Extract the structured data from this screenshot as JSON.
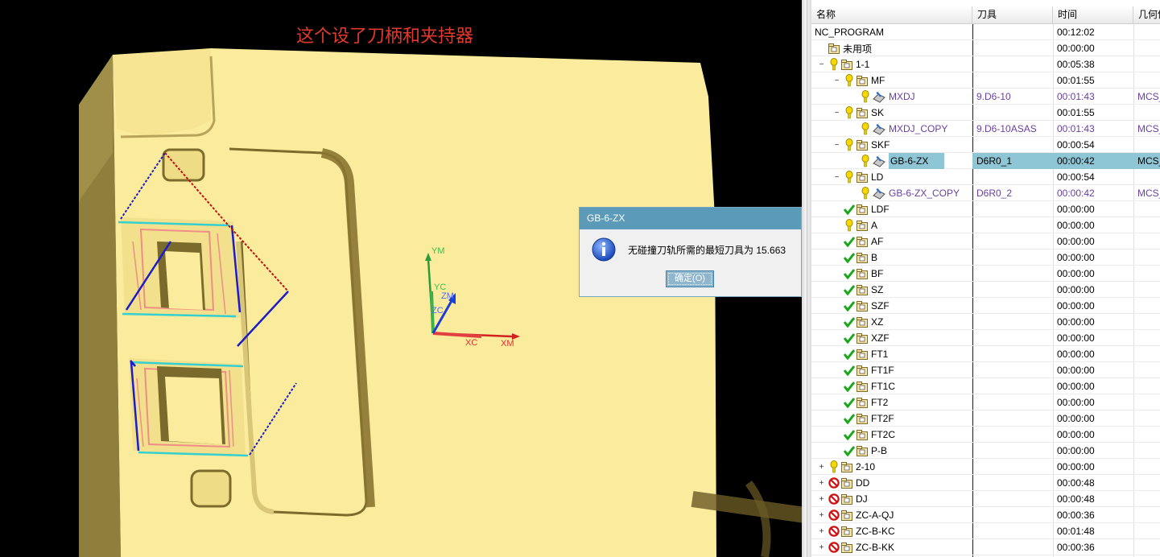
{
  "viewport": {
    "annotation": "这个设了刀柄和夹持器",
    "axis_labels": [
      "YM",
      "YC",
      "ZM",
      "ZC",
      "XC",
      "XM"
    ]
  },
  "dialog": {
    "title": "GB-6-ZX",
    "message": "无碰撞刀轨所需的最短刀具为 15.663",
    "ok_label": "确定(O)",
    "icon": "info-icon"
  },
  "navigator": {
    "columns": [
      "名称",
      "刀具",
      "时间",
      "几何体"
    ],
    "rows": [
      {
        "name": "NC_PROGRAM",
        "level": 0,
        "tool": "",
        "time": "00:12:02",
        "geom": "",
        "status": "none",
        "kind": "root"
      },
      {
        "name": "未用项",
        "level": 1,
        "tool": "",
        "time": "00:00:00",
        "geom": "",
        "status": "none",
        "kind": "folder"
      },
      {
        "name": "1-1",
        "level": 1,
        "tool": "",
        "time": "00:05:38",
        "geom": "",
        "status": "warn",
        "kind": "group",
        "expander": "-"
      },
      {
        "name": "MF",
        "level": 2,
        "tool": "",
        "time": "00:01:55",
        "geom": "",
        "status": "warn",
        "kind": "group",
        "expander": "-"
      },
      {
        "name": "MXDJ",
        "level": 3,
        "tool": "9.D6-10",
        "time": "00:01:43",
        "geom": "MCS_",
        "status": "warn",
        "kind": "op",
        "purple": true
      },
      {
        "name": "SK",
        "level": 2,
        "tool": "",
        "time": "00:01:55",
        "geom": "",
        "status": "warn",
        "kind": "group",
        "expander": "-"
      },
      {
        "name": "MXDJ_COPY",
        "level": 3,
        "tool": "9.D6-10ASAS",
        "time": "00:01:43",
        "geom": "MCS_",
        "status": "warn",
        "kind": "op",
        "purple": true
      },
      {
        "name": "SKF",
        "level": 2,
        "tool": "",
        "time": "00:00:54",
        "geom": "",
        "status": "warn",
        "kind": "group",
        "expander": "-"
      },
      {
        "name": "GB-6-ZX",
        "level": 3,
        "tool": "D6R0_1",
        "time": "00:00:42",
        "geom": "MCS_",
        "status": "warn",
        "kind": "op",
        "selected": true
      },
      {
        "name": "LD",
        "level": 2,
        "tool": "",
        "time": "00:00:54",
        "geom": "",
        "status": "warn",
        "kind": "group",
        "expander": "-"
      },
      {
        "name": "GB-6-ZX_COPY",
        "level": 3,
        "tool": "D6R0_2",
        "time": "00:00:42",
        "geom": "MCS_",
        "status": "warn",
        "kind": "op",
        "purple": true
      },
      {
        "name": "LDF",
        "level": 2,
        "tool": "",
        "time": "00:00:00",
        "geom": "",
        "status": "ok",
        "kind": "group"
      },
      {
        "name": "A",
        "level": 2,
        "tool": "",
        "time": "00:00:00",
        "geom": "",
        "status": "warn",
        "kind": "group"
      },
      {
        "name": "AF",
        "level": 2,
        "tool": "",
        "time": "00:00:00",
        "geom": "",
        "status": "ok",
        "kind": "group"
      },
      {
        "name": "B",
        "level": 2,
        "tool": "",
        "time": "00:00:00",
        "geom": "",
        "status": "ok",
        "kind": "group"
      },
      {
        "name": "BF",
        "level": 2,
        "tool": "",
        "time": "00:00:00",
        "geom": "",
        "status": "ok",
        "kind": "group"
      },
      {
        "name": "SZ",
        "level": 2,
        "tool": "",
        "time": "00:00:00",
        "geom": "",
        "status": "ok",
        "kind": "group"
      },
      {
        "name": "SZF",
        "level": 2,
        "tool": "",
        "time": "00:00:00",
        "geom": "",
        "status": "ok",
        "kind": "group"
      },
      {
        "name": "XZ",
        "level": 2,
        "tool": "",
        "time": "00:00:00",
        "geom": "",
        "status": "ok",
        "kind": "group"
      },
      {
        "name": "XZF",
        "level": 2,
        "tool": "",
        "time": "00:00:00",
        "geom": "",
        "status": "ok",
        "kind": "group"
      },
      {
        "name": "FT1",
        "level": 2,
        "tool": "",
        "time": "00:00:00",
        "geom": "",
        "status": "ok",
        "kind": "group"
      },
      {
        "name": "FT1F",
        "level": 2,
        "tool": "",
        "time": "00:00:00",
        "geom": "",
        "status": "ok",
        "kind": "group"
      },
      {
        "name": "FT1C",
        "level": 2,
        "tool": "",
        "time": "00:00:00",
        "geom": "",
        "status": "ok",
        "kind": "group"
      },
      {
        "name": "FT2",
        "level": 2,
        "tool": "",
        "time": "00:00:00",
        "geom": "",
        "status": "ok",
        "kind": "group"
      },
      {
        "name": "FT2F",
        "level": 2,
        "tool": "",
        "time": "00:00:00",
        "geom": "",
        "status": "ok",
        "kind": "group"
      },
      {
        "name": "FT2C",
        "level": 2,
        "tool": "",
        "time": "00:00:00",
        "geom": "",
        "status": "ok",
        "kind": "group"
      },
      {
        "name": "P-B",
        "level": 2,
        "tool": "",
        "time": "00:00:00",
        "geom": "",
        "status": "ok",
        "kind": "group"
      },
      {
        "name": "2-10",
        "level": 1,
        "tool": "",
        "time": "00:00:00",
        "geom": "",
        "status": "warn",
        "kind": "group",
        "expander": "+"
      },
      {
        "name": "DD",
        "level": 1,
        "tool": "",
        "time": "00:00:48",
        "geom": "",
        "status": "forbid",
        "kind": "group",
        "expander": "+"
      },
      {
        "name": "DJ",
        "level": 1,
        "tool": "",
        "time": "00:00:48",
        "geom": "",
        "status": "forbid",
        "kind": "group",
        "expander": "+"
      },
      {
        "name": "ZC-A-QJ",
        "level": 1,
        "tool": "",
        "time": "00:00:36",
        "geom": "",
        "status": "forbid",
        "kind": "group",
        "expander": "+"
      },
      {
        "name": "ZC-B-KC",
        "level": 1,
        "tool": "",
        "time": "00:01:48",
        "geom": "",
        "status": "forbid",
        "kind": "group",
        "expander": "+"
      },
      {
        "name": "ZC-B-KK",
        "level": 1,
        "tool": "",
        "time": "00:00:36",
        "geom": "",
        "status": "forbid",
        "kind": "group",
        "expander": "+"
      }
    ]
  }
}
